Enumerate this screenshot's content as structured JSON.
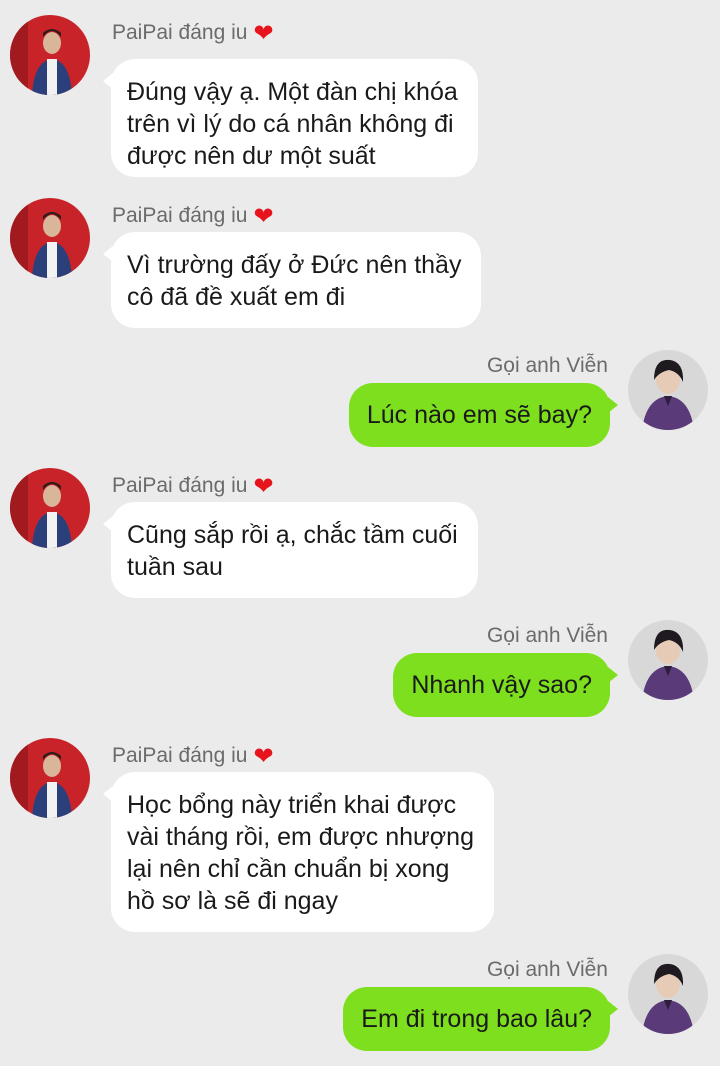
{
  "contacts": {
    "them": {
      "name": "PaiPai đáng iu",
      "heart": "❤",
      "avatar_icon": "avatar-red-wall-icon"
    },
    "me": {
      "name": "Gọi anh Viễn",
      "avatar_icon": "avatar-purple-jacket-icon"
    }
  },
  "colors": {
    "background": "#ebebeb",
    "incoming_bubble": "#ffffff",
    "outgoing_bubble": "#7ddf1d",
    "heart": "#e8141c"
  },
  "messages": [
    {
      "from": "them",
      "lines": [
        "Đúng vậy ạ. Một đàn chị khóa",
        "trên vì lý do cá nhân không đi",
        "được nên dư một suất"
      ]
    },
    {
      "from": "them",
      "lines": [
        "Vì trường đấy ở Đức nên thầy",
        "cô đã đề xuất em đi"
      ]
    },
    {
      "from": "me",
      "lines": [
        "Lúc nào em sẽ bay?"
      ]
    },
    {
      "from": "them",
      "lines": [
        "Cũng sắp rồi ạ, chắc tầm cuối",
        "tuần sau"
      ]
    },
    {
      "from": "me",
      "lines": [
        "Nhanh vậy sao?"
      ]
    },
    {
      "from": "them",
      "lines": [
        "Học bổng này triển khai được",
        "vài tháng rồi, em được nhượng",
        "lại nên chỉ cần chuẩn bị xong",
        "hồ sơ là sẽ đi ngay"
      ]
    },
    {
      "from": "me",
      "lines": [
        "Em đi trong bao lâu?"
      ]
    }
  ]
}
